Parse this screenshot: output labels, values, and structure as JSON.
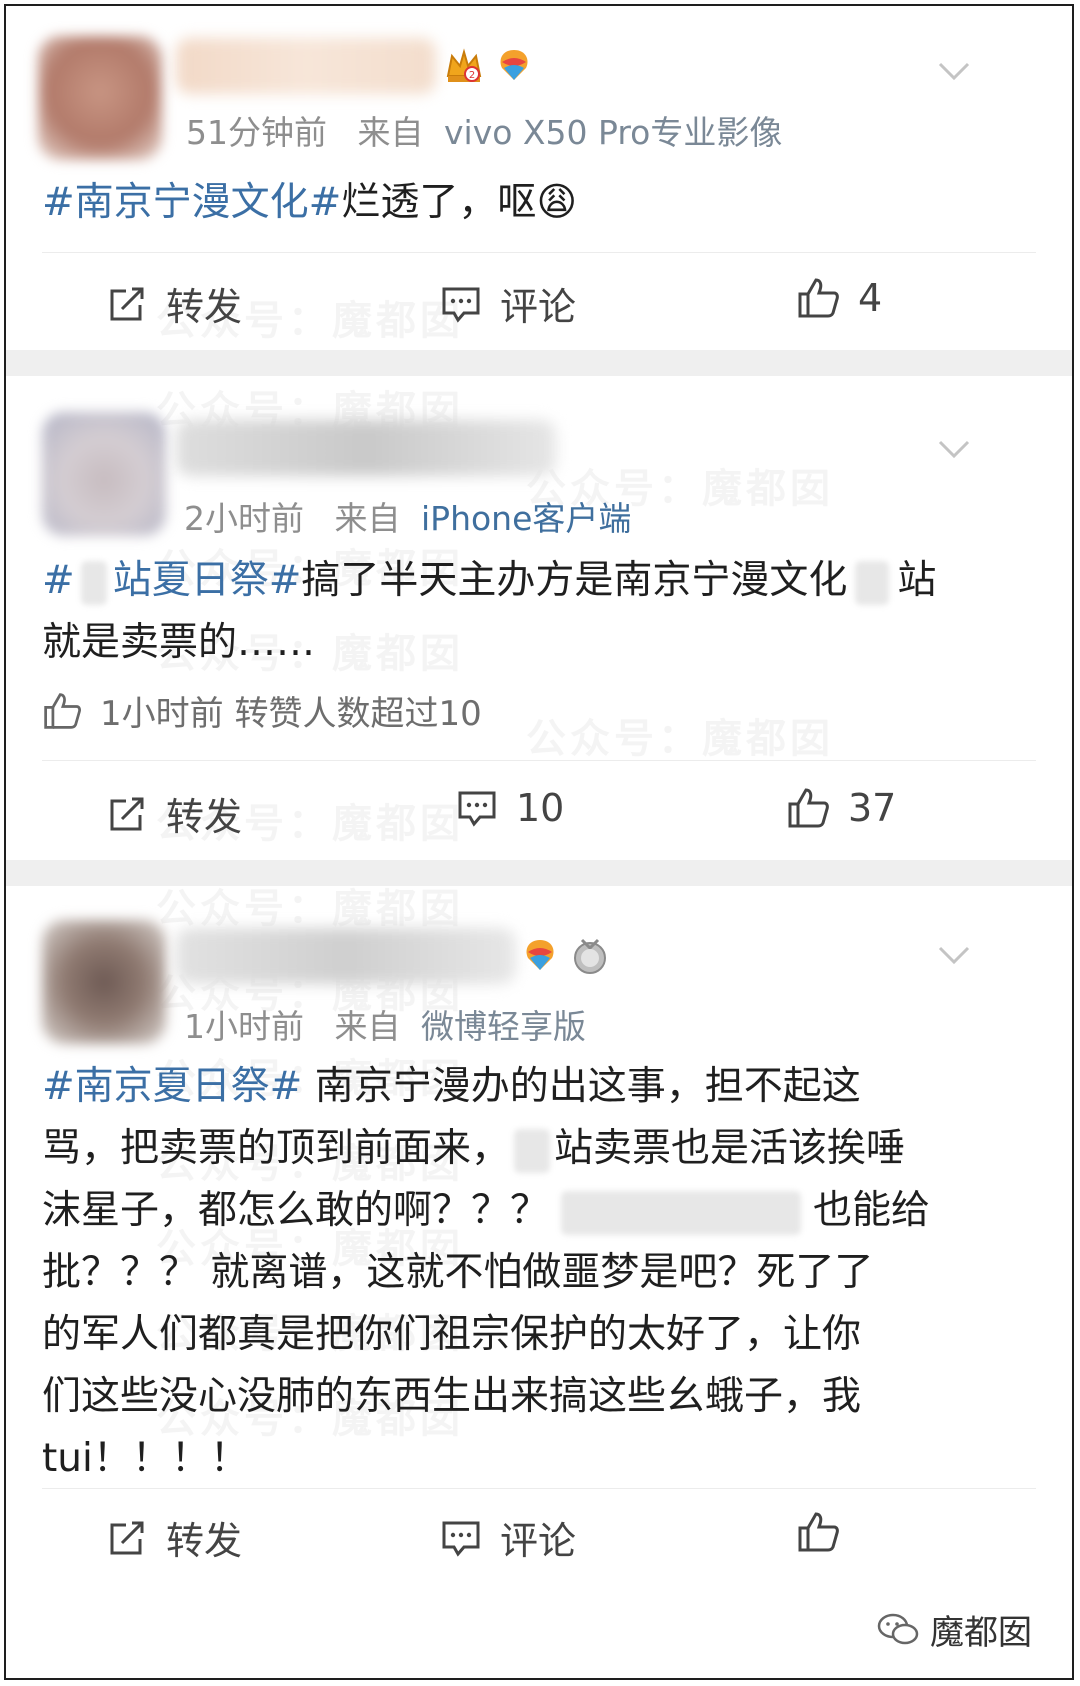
{
  "posts": [
    {
      "time": "51分钟前",
      "source_prefix": "来自",
      "source": "vivo X50 Pro专业影像",
      "text": {
        "tag": "#南京宁漫文化#",
        "body": "烂透了，呕",
        "emoji": "😩"
      },
      "actions": {
        "repost": "转发",
        "comment": "评论",
        "like": "4"
      }
    },
    {
      "time": "2小时前",
      "source_prefix": "来自",
      "source": "iPhone客户端",
      "text": {
        "tag_a": "#",
        "tag_b": "站夏日祭#",
        "line1_rest": "搞了半天主办方是南京宁漫文化",
        "line1_end": "站",
        "line2": "就是卖票的……"
      },
      "like_info": "1小时前 转赞人数超过10",
      "actions": {
        "repost": "转发",
        "comment": "10",
        "like": "37"
      }
    },
    {
      "time": "1小时前",
      "source_prefix": "来自",
      "source": "微博轻享版",
      "text": {
        "tag": "#南京夏日祭#",
        "line1_rest": " 南京宁漫办的出这事，担不起这",
        "line2_a": "骂，把卖票的顶到前面来，",
        "line2_b": "站卖票也是活该挨唾",
        "line3_a": "沫星子，都怎么敢的啊？？？",
        "line3_b": "也能给",
        "line4": "批？？？ 就离谱，这就不怕做噩梦是吧？死了了",
        "line5": "的军人们都真是把你们祖宗保护的太好了，让你",
        "line6": "们这些没心没肺的东西生出来搞这些幺蛾子，我",
        "line7": "tui！！！！"
      },
      "actions": {
        "repost": "转发",
        "comment": "评论",
        "like": ""
      }
    }
  ],
  "watermark": "公众号：魔都囡",
  "brand": "魔都囡",
  "colors": {
    "tag": "#3b6fa5",
    "meta": "#8e8e8e",
    "separator": "#efefef"
  }
}
